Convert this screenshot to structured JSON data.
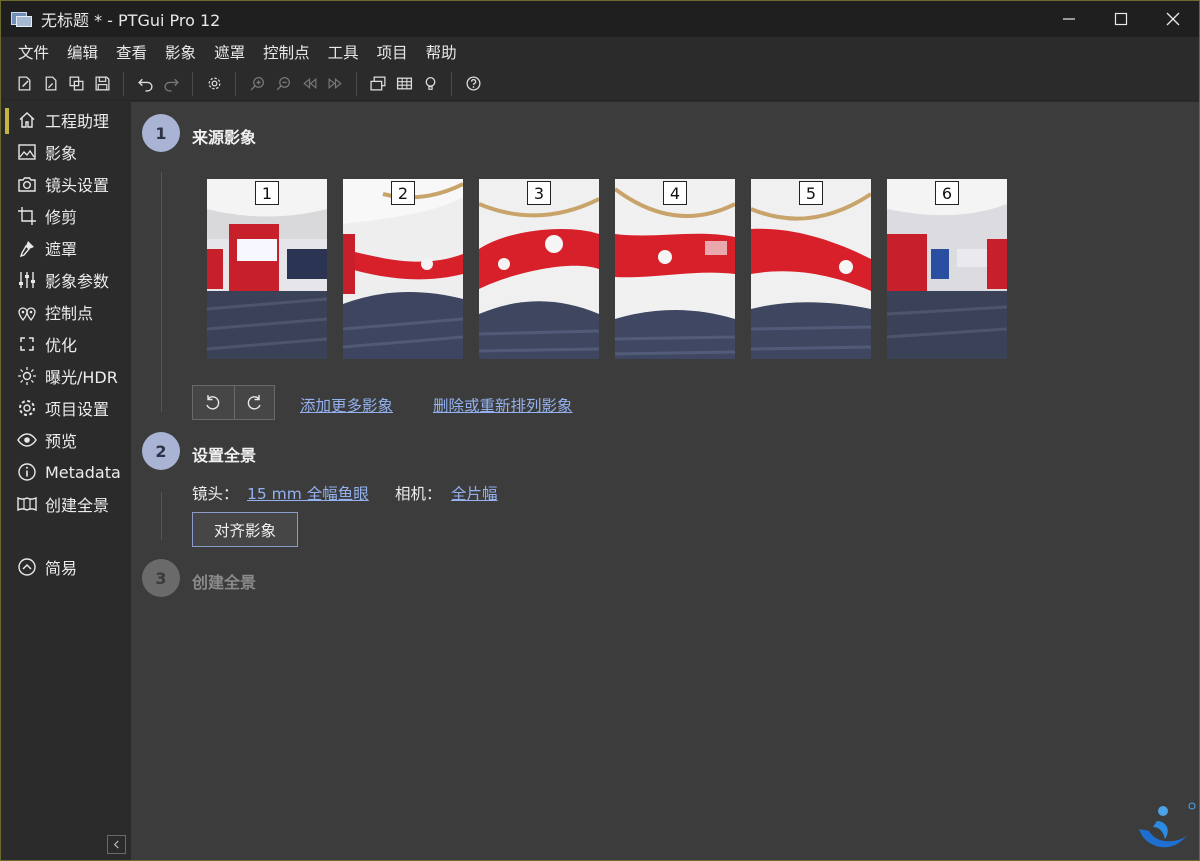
{
  "window": {
    "title": "无标题 * - PTGui Pro 12"
  },
  "menu": [
    "文件",
    "编辑",
    "查看",
    "影象",
    "遮罩",
    "控制点",
    "工具",
    "项目",
    "帮助"
  ],
  "sidebar": {
    "items": [
      {
        "label": "工程助理",
        "icon": "home-icon",
        "active": true
      },
      {
        "label": "影象",
        "icon": "image-icon"
      },
      {
        "label": "镜头设置",
        "icon": "camera-icon"
      },
      {
        "label": "修剪",
        "icon": "crop-icon"
      },
      {
        "label": "遮罩",
        "icon": "brush-icon"
      },
      {
        "label": "影象参数",
        "icon": "sliders-icon"
      },
      {
        "label": "控制点",
        "icon": "control-points-icon"
      },
      {
        "label": "优化",
        "icon": "optimize-icon"
      },
      {
        "label": "曝光/HDR",
        "icon": "sun-icon"
      },
      {
        "label": "项目设置",
        "icon": "gear-icon"
      },
      {
        "label": "预览",
        "icon": "eye-icon"
      },
      {
        "label": "Metadata",
        "icon": "info-icon"
      },
      {
        "label": "创建全景",
        "icon": "panorama-icon"
      }
    ],
    "simple": {
      "label": "简易",
      "icon": "chevron-up-circle-icon"
    }
  },
  "steps": [
    {
      "num": "1",
      "title": "来源影象"
    },
    {
      "num": "2",
      "title": "设置全景"
    },
    {
      "num": "3",
      "title": "创建全景"
    }
  ],
  "thumbnails": [
    "1",
    "2",
    "3",
    "4",
    "5",
    "6"
  ],
  "links": {
    "add_more": "添加更多影象",
    "delete_reorder": "删除或重新排列影象",
    "lens_value": "15 mm 全幅鱼眼",
    "camera_value": "全片幅"
  },
  "labels": {
    "lens": "镜头：",
    "camera": "相机："
  },
  "buttons": {
    "align": "对齐影象"
  },
  "colors": {
    "accent": "#c8b446",
    "step_active": "#a9b3d3",
    "link": "#93b1ee",
    "panorama_red": "#d8202a"
  }
}
